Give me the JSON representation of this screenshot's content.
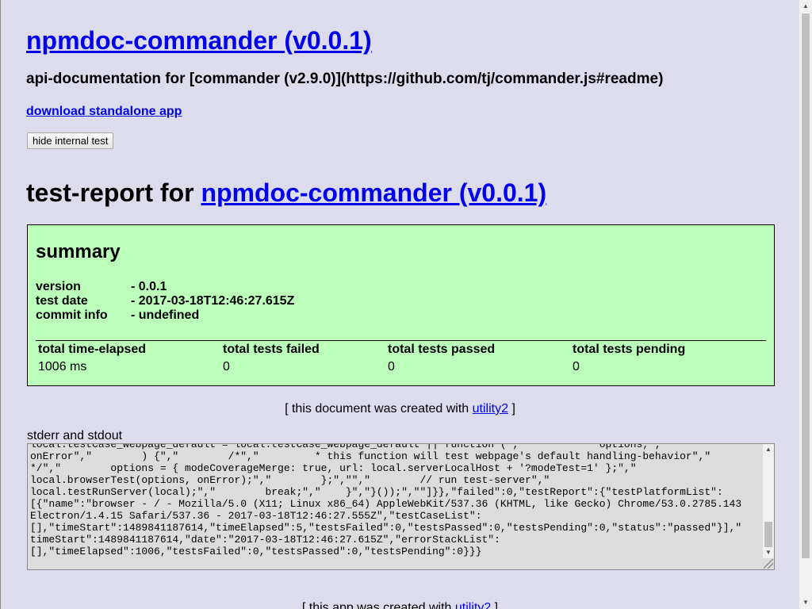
{
  "header": {
    "title": "npmdoc-commander (v0.0.1)",
    "api_doc": "api-documentation for [commander (v2.9.0)](https://github.com/tj/commander.js#readme)",
    "download_link": "download standalone app",
    "hide_button": "hide internal test"
  },
  "report": {
    "prefix": "test-report for ",
    "link": "npmdoc-commander (v0.0.1)"
  },
  "summary": {
    "title": "summary",
    "info": [
      {
        "label": "version",
        "value": "- 0.0.1"
      },
      {
        "label": "test date",
        "value": "- 2017-03-18T12:46:27.615Z"
      },
      {
        "label": "commit info",
        "value": "- undefined"
      }
    ],
    "stats": [
      {
        "label": "total time-elapsed",
        "value": "1006 ms"
      },
      {
        "label": "total tests failed",
        "value": "0"
      },
      {
        "label": "total tests passed",
        "value": "0"
      },
      {
        "label": "total tests pending",
        "value": "0"
      }
    ],
    "colors": {
      "background": "#bbffbb"
    }
  },
  "created_with": {
    "prefix": "[ this document was created with ",
    "link": "utility2",
    "suffix": " ]"
  },
  "stdout": {
    "label": "stderr and stdout",
    "content": "local.testCase_webpage_default = local.testCase_webpage_default || function (\",\"            options,\",\nonError\",\"        ) {\",\"        /*\",\"         * this function will test webpage's default handling-behavior\",\"\n*/\",\"        options = { modeCoverageMerge: true, url: local.serverLocalHost + '?modeTest=1' };\",\"\nlocal.browserTest(options, onError);\",\"        };\",\"\",\"        // run test-server\",\"\nlocal.testRunServer(local);\",\"        break;\",\"    }\",\"}());\",\"\"]}},\"failed\":0,\"testReport\":{\"testPlatformList\":\n[{\"name\":\"browser - / - Mozilla/5.0 (X11; Linux x86_64) AppleWebKit/537.36 (KHTML, like Gecko) Chrome/53.0.2785.143\nElectron/1.4.15 Safari/537.36 - 2017-03-18T12:46:27.555Z\",\"testCaseList\":\n[],\"timeStart\":1489841187614,\"timeElapsed\":5,\"testsFailed\":0,\"testsPassed\":0,\"testsPending\":0,\"status\":\"passed\"}],\"\ntimeStart\":1489841187614,\"date\":\"2017-03-18T12:46:27.615Z\",\"errorStackList\":\n[],\"timeElapsed\":1006,\"testsFailed\":0,\"testsPassed\":0,\"testsPending\":0}}}"
  },
  "footer": {
    "prefix": "[ this app was created with ",
    "link": "utility2",
    "suffix": " ]"
  }
}
